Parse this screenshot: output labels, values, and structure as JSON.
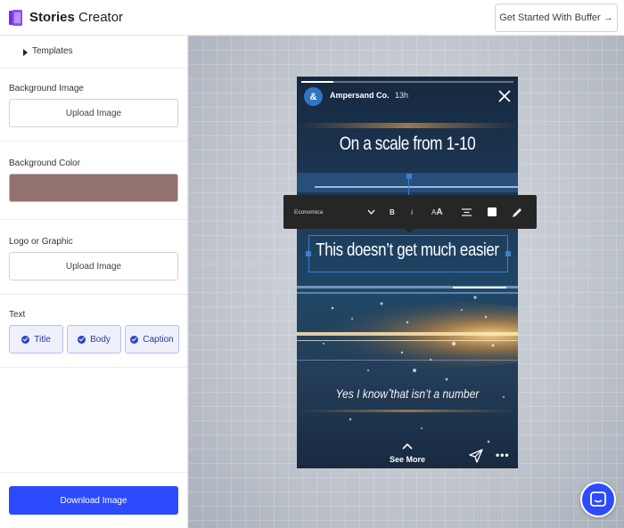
{
  "app": {
    "brand_bold": "Stories",
    "brand_rest": " Creator",
    "cta_label": "Get Started With Buffer →"
  },
  "sidebar": {
    "templates_label": "Templates",
    "background_image": {
      "label": "Background Image",
      "button": "Upload Image"
    },
    "background_color": {
      "label": "Background Color",
      "value": "#927270"
    },
    "logo": {
      "label": "Logo or Graphic",
      "button": "Upload Image"
    },
    "text": {
      "label": "Text",
      "chips": [
        "Title",
        "Body",
        "Caption"
      ]
    },
    "download_label": "Download Image"
  },
  "story": {
    "account_initial": "&",
    "account_name": "Ampersand Co.",
    "age": "13h",
    "progress": 0.15,
    "headline": "On a scale from 1-10",
    "body": "This doesn’t get much easier",
    "caption": "Yes I know that isn’t a number",
    "see_more": "See More"
  },
  "toolbar": {
    "font_name": "Economica",
    "bold": "B",
    "italic": "i",
    "size_small": "A",
    "size_big": "A"
  },
  "colors": {
    "accent": "#2c4bff",
    "selection": "#3b7fd6",
    "toolbar_bg": "#262626",
    "chip_bg": "#eef1fc"
  }
}
